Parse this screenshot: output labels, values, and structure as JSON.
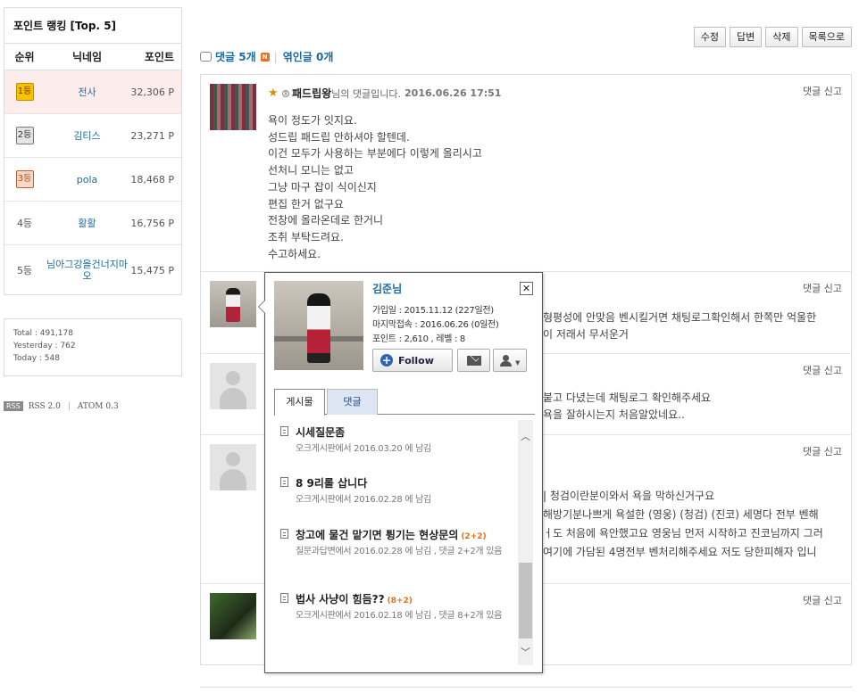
{
  "ranking": {
    "title": "포인트 랭킹 [Top. 5]",
    "headers": {
      "rank": "순위",
      "nickname": "닉네임",
      "points": "포인트"
    },
    "rows": [
      {
        "rank": "1등",
        "nickname": "전사",
        "points": "32,306 P"
      },
      {
        "rank": "2등",
        "nickname": "김티스",
        "points": "23,271 P"
      },
      {
        "rank": "3등",
        "nickname": "pola",
        "points": "18,468 P"
      },
      {
        "rank": "4등",
        "nickname": "활활",
        "points": "16,756 P"
      },
      {
        "rank": "5등",
        "nickname": "님아그강을건너지마오",
        "points": "15,475 P"
      }
    ]
  },
  "stats": {
    "total": "Total : 491,178",
    "yesterday": "Yesterday : 762",
    "today": "Today : 548"
  },
  "feeds": {
    "rss_badge": "RSS",
    "rss": "RSS 2.0",
    "atom": "ATOM 0.3"
  },
  "toolbar": {
    "edit": "수정",
    "reply": "답변",
    "delete": "삭제",
    "list": "목록으로"
  },
  "comment_header": {
    "comments": "댓글 5개",
    "new_badge": "N",
    "trackbacks": "엮인글 0개"
  },
  "comment_actions": {
    "reply": "댓글",
    "report": "신고"
  },
  "comments": [
    {
      "author": "패드립왕",
      "suffix": "님의 댓글입니다.",
      "date": "2016.06.26 17:51",
      "lines": [
        "욕이 정도가 잇지요.",
        "성드립 패드립 안하셔야 할텐데.",
        "이건 모두가 사용하는 부분에다 이렇게 올리시고",
        "선처니 모니는 없고",
        "그냥 마구 잡이 식이신지",
        "편집 한거 없구요",
        "전창에 올라온데로 한거니",
        "조취 부탁드려요.",
        "수고하세요."
      ]
    },
    {
      "lines": [
        "형평성에 안맞음 벤시킬거면 채팅로그확인해서 한쪽만 억울한",
        "이 저래서 무서운거"
      ]
    },
    {
      "lines": [
        "붙고 다녔는데 채팅로그 확인해주세요",
        "욕을 잘하시는지 처음알았네요.."
      ]
    },
    {
      "lines": [
        "| 청검이란분이와서 욕을 막하신거구요",
        "해방기분나쁘게 욕설한 (영웅) (청검) (진코) 세명다 전부 벤해",
        "ㅓ도 처음에 욕안했고요 영웅님 먼저 시작하고 진코님까지 그러",
        "여기에 가담된 4명전부 벤처리해주세요 저도 당한피해자 입니"
      ]
    },
    {
      "lines": []
    }
  ],
  "profile": {
    "name": "김준님",
    "joined": "가입일 : 2015.11.12 (227일전)",
    "last_login": "마지막접속 : 2016.06.26 (0일전)",
    "points_level": "포인트 : 2,610 , 레벨 : 8",
    "follow": "Follow",
    "close": "✕",
    "tabs": [
      "게시물",
      "댓글"
    ],
    "posts": [
      {
        "title": "시세질문좀",
        "count": "",
        "meta": "오크게시판에서 2016.03.20 에 남김"
      },
      {
        "title": "8 9리롤 삽니다",
        "count": "",
        "meta": "오크게시판에서 2016.02.28 에 남김"
      },
      {
        "title": "창고에 물건 맡기면 튕기는 현상문의",
        "count": "(2+2)",
        "meta": "질문과답변에서 2016.02.28 에 남김 , 댓글 2+2개 있음"
      },
      {
        "title": "법사 사냥이 힘듬??",
        "count": "(8+2)",
        "meta": "오크게시판에서 2016.02.18 에 남김 , 댓글 8+2개 있음"
      }
    ]
  }
}
